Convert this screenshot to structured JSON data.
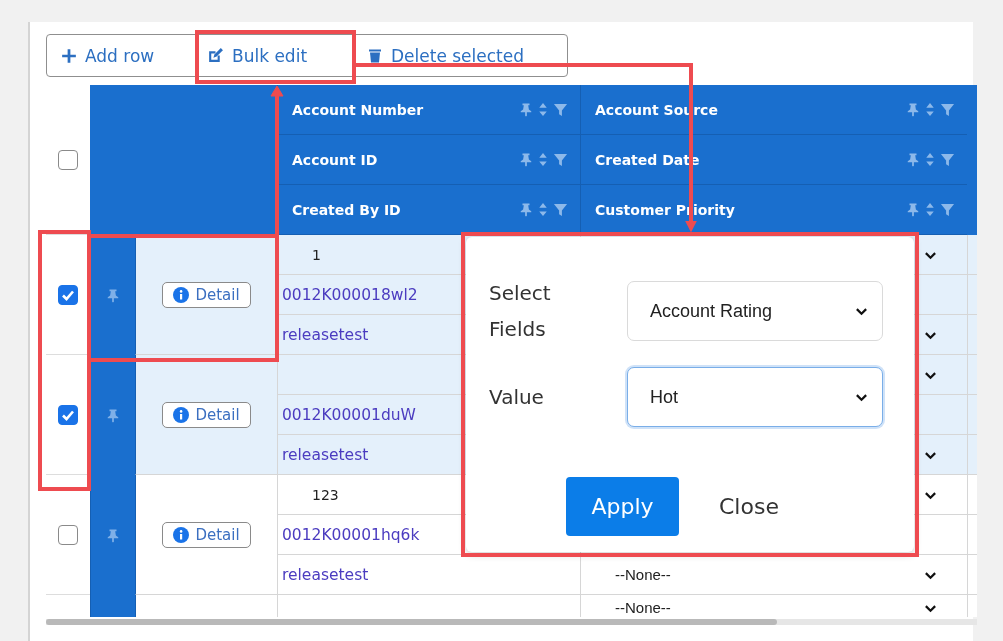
{
  "toolbar": {
    "buttons": [
      {
        "kind": "add",
        "label": "Add row"
      },
      {
        "kind": "edit",
        "label": "Bulk edit"
      },
      {
        "kind": "delete",
        "label": "Delete selected"
      }
    ]
  },
  "table": {
    "select_all": {
      "checked": false
    },
    "header_rows": [
      [
        "Account Number",
        "Account Source"
      ],
      [
        "Account ID",
        "Created Date"
      ],
      [
        "Created By ID",
        "Customer Priority"
      ]
    ],
    "rows": [
      {
        "checked": true,
        "detail_label": "Detail",
        "lines": [
          {
            "col_a": {
              "kind": "number",
              "text": "1"
            },
            "col_b": {
              "kind": "dropdown"
            }
          },
          {
            "col_a": {
              "kind": "link",
              "text": "0012K000018wl2"
            },
            "col_b": {
              "kind": "blank"
            }
          },
          {
            "col_a": {
              "kind": "link",
              "text": "releasetest"
            },
            "col_b": {
              "kind": "dropdown"
            }
          }
        ]
      },
      {
        "checked": true,
        "detail_label": "Detail",
        "lines": [
          {
            "col_a": {
              "kind": "number"
            },
            "col_b": {
              "kind": "dropdown"
            }
          },
          {
            "col_a": {
              "kind": "link",
              "text": "0012K00001duW"
            },
            "col_b": {
              "kind": "blank"
            }
          },
          {
            "col_a": {
              "kind": "link",
              "text": "releasetest"
            },
            "col_b": {
              "kind": "dropdown"
            }
          }
        ]
      },
      {
        "checked": false,
        "detail_label": "Detail",
        "lines": [
          {
            "col_a": {
              "kind": "number",
              "text": "123"
            },
            "col_b": {
              "kind": "dropdown"
            }
          },
          {
            "col_a": {
              "kind": "link",
              "text": "0012K00001hq6k"
            },
            "col_b": {
              "kind": "blank"
            }
          },
          {
            "col_a": {
              "kind": "link",
              "text": "releasetest"
            },
            "col_b": {
              "kind": "dropdown",
              "value": "--None--"
            }
          }
        ]
      },
      {
        "lines": [
          {
            "col_a": {
              "kind": "number"
            },
            "col_b": {
              "kind": "dropdown",
              "value": "--None--"
            }
          }
        ]
      }
    ]
  },
  "bulk_edit_popup": {
    "fields": [
      {
        "label": "Select Fields",
        "value": "Account Rating",
        "focused": false
      },
      {
        "label": "Value",
        "value": "Hot",
        "focused": true
      }
    ],
    "buttons": [
      {
        "kind": "primary",
        "label": "Apply"
      },
      {
        "kind": "plain",
        "label": "Close"
      }
    ]
  }
}
